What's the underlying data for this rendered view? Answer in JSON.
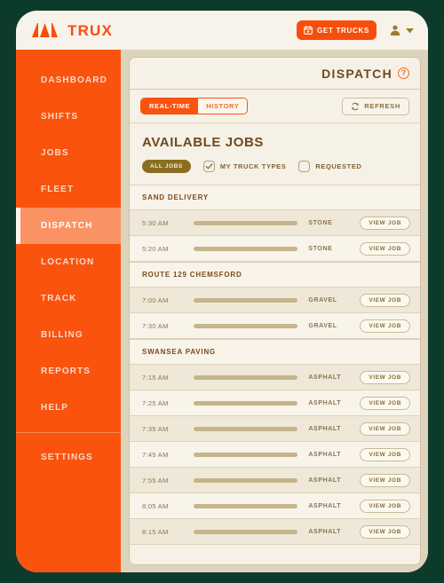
{
  "topbar": {
    "logo_text": "TRUX",
    "get_trucks_label": "GET TRUCKS",
    "calendar_icon": "calendar-icon",
    "avatar_icon": "person-icon",
    "caret_icon": "chevron-down-icon"
  },
  "sidebar": {
    "items": [
      {
        "label": "DASHBOARD",
        "active": false
      },
      {
        "label": "SHIFTS",
        "active": false
      },
      {
        "label": "JOBS",
        "active": false
      },
      {
        "label": "FLEET",
        "active": false
      },
      {
        "label": "DISPATCH",
        "active": true
      },
      {
        "label": "LOCATION",
        "active": false
      },
      {
        "label": "TRACK",
        "active": false
      },
      {
        "label": "BILLING",
        "active": false
      },
      {
        "label": "REPORTS",
        "active": false
      },
      {
        "label": "HELP",
        "active": false
      }
    ],
    "footer_items": [
      {
        "label": "SETTINGS",
        "active": false
      }
    ]
  },
  "panel": {
    "title": "DISPATCH",
    "help_icon": "question-mark-icon",
    "toolbar": {
      "segments": [
        {
          "label": "REAL-TIME",
          "selected": true
        },
        {
          "label": "HISTORY",
          "selected": false
        }
      ],
      "refresh_label": "REFRESH",
      "refresh_icon": "refresh-icon"
    },
    "available_jobs_title": "AVAILABLE JOBS",
    "filters": {
      "chip_label": "ALL JOBS",
      "options": [
        {
          "label": "MY TRUCK TYPES",
          "checked": true
        },
        {
          "label": "REQUESTED",
          "checked": false
        }
      ]
    },
    "view_job_label": "VIEW JOB",
    "sections": [
      {
        "name": "SAND DELIVERY",
        "rows": [
          {
            "time": "5:30 AM",
            "material": "STONE",
            "progress": 100
          },
          {
            "time": "5:20 AM",
            "material": "STONE",
            "progress": 100
          }
        ]
      },
      {
        "name": "ROUTE 129 CHEMSFORD",
        "rows": [
          {
            "time": "7:00 AM",
            "material": "GRAVEL",
            "progress": 100
          },
          {
            "time": "7:30 AM",
            "material": "GRAVEL",
            "progress": 100
          }
        ]
      },
      {
        "name": "SWANSEA PAVING",
        "rows": [
          {
            "time": "7:15 AM",
            "material": "ASPHALT",
            "progress": 100
          },
          {
            "time": "7:25 AM",
            "material": "ASPHALT",
            "progress": 100
          },
          {
            "time": "7:35 AM",
            "material": "ASPHALT",
            "progress": 100
          },
          {
            "time": "7:45 AM",
            "material": "ASPHALT",
            "progress": 100
          },
          {
            "time": "7:55 AM",
            "material": "ASPHALT",
            "progress": 100
          },
          {
            "time": "8:05 AM",
            "material": "ASPHALT",
            "progress": 100
          },
          {
            "time": "8:15 AM",
            "material": "ASPHALT",
            "progress": 100
          }
        ]
      }
    ]
  },
  "colors": {
    "frame": "#0c3b2c",
    "brand_orange": "#f9530e",
    "accent_orange": "#f26b27",
    "sidebar_active": "#fb9264",
    "panel_bg": "#f6f1e6",
    "main_bg": "#ded3bc",
    "title_brown": "#6d4b22",
    "chip_olive": "#8a6d20",
    "bar_tan": "#c6b48b"
  }
}
